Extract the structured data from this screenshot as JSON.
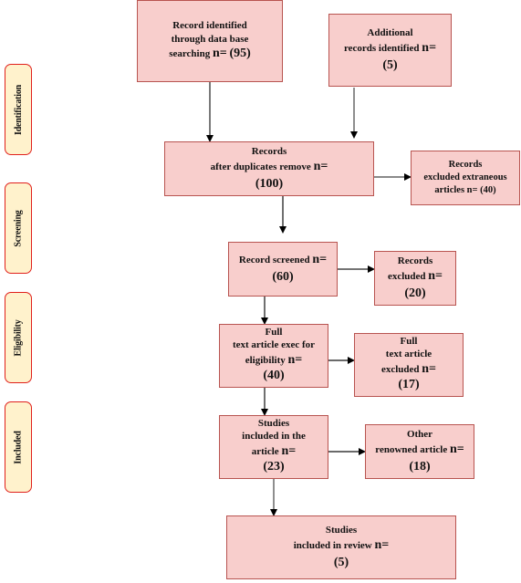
{
  "phases": [
    {
      "label": "Identification"
    },
    {
      "label": "Screening"
    },
    {
      "label": "Eligibility"
    },
    {
      "label": "Included"
    }
  ],
  "boxes": {
    "database_search": {
      "lines": [
        "Record identified",
        "through data base"
      ],
      "last": "searching",
      "n_label": "n=",
      "count": "(95)"
    },
    "additional_records": {
      "lines": [
        "Additional"
      ],
      "last": "records identified",
      "n_label": "n=",
      "count": "(5)"
    },
    "after_duplicates": {
      "lines": [
        "Records"
      ],
      "last": "after duplicates remove",
      "n_label": "n=",
      "count": "(100)"
    },
    "excluded_extraneous": {
      "lines": [
        "Records",
        "excluded  extraneous"
      ],
      "last": "articles  n= (40)"
    },
    "screened": {
      "last": "Record screened",
      "n_label": "n=",
      "count": "(60)"
    },
    "records_excluded": {
      "lines": [
        "Records"
      ],
      "last": "excluded",
      "n_label": "n=",
      "count": "(20)"
    },
    "full_text_eligibility": {
      "lines": [
        "Full",
        "text article exec for"
      ],
      "last": "eligibility",
      "n_label": "n=",
      "count": "(40)"
    },
    "full_text_excluded": {
      "lines": [
        "Full",
        "text article"
      ],
      "last": "excluded",
      "n_label": "n=",
      "count": "(17)"
    },
    "studies_in_article": {
      "lines": [
        "Studies",
        "included in the"
      ],
      "last": "article",
      "n_label": "n=",
      "count": "(23)"
    },
    "other_renowned": {
      "lines": [
        "Other"
      ],
      "last": "renowned article",
      "n_label": "n=",
      "count": "(18)"
    },
    "included_in_review": {
      "lines": [
        "Studies"
      ],
      "last": "included in review",
      "n_label": "n=",
      "count": "(5)"
    }
  },
  "colors": {
    "box_fill": "#f8cecc",
    "box_border": "#b85450",
    "phase_fill": "#fff2cc",
    "phase_border": "#e0201c",
    "arrow": "#000000"
  }
}
